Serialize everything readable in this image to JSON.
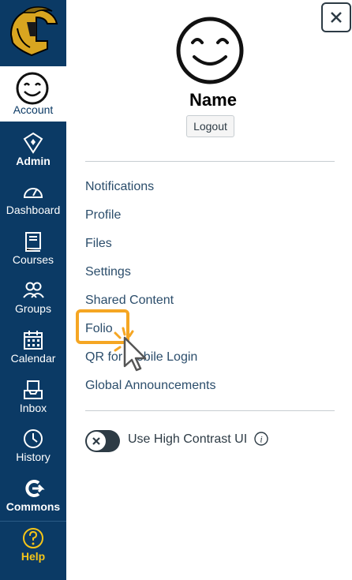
{
  "global_nav": {
    "items": [
      {
        "label": "Account",
        "icon": "smiley-icon"
      },
      {
        "label": "Admin",
        "icon": "shield-icon"
      },
      {
        "label": "Dashboard",
        "icon": "speedometer-icon"
      },
      {
        "label": "Courses",
        "icon": "book-icon"
      },
      {
        "label": "Groups",
        "icon": "people-icon"
      },
      {
        "label": "Calendar",
        "icon": "calendar-icon"
      },
      {
        "label": "Inbox",
        "icon": "inbox-icon"
      },
      {
        "label": "History",
        "icon": "clock-icon"
      },
      {
        "label": "Commons",
        "icon": "commons-icon"
      },
      {
        "label": "Help",
        "icon": "help-icon"
      }
    ],
    "colors": {
      "background": "#0b3a65",
      "help_accent": "#f5c518"
    }
  },
  "tray": {
    "user_name": "Name",
    "logout_label": "Logout",
    "links": [
      "Notifications",
      "Profile",
      "Files",
      "Settings",
      "Shared Content",
      "Folio",
      "QR for Mobile Login",
      "Global Announcements"
    ],
    "high_contrast_label": "Use High Contrast UI",
    "high_contrast_enabled": false
  },
  "highlight_color": "#f5a623"
}
